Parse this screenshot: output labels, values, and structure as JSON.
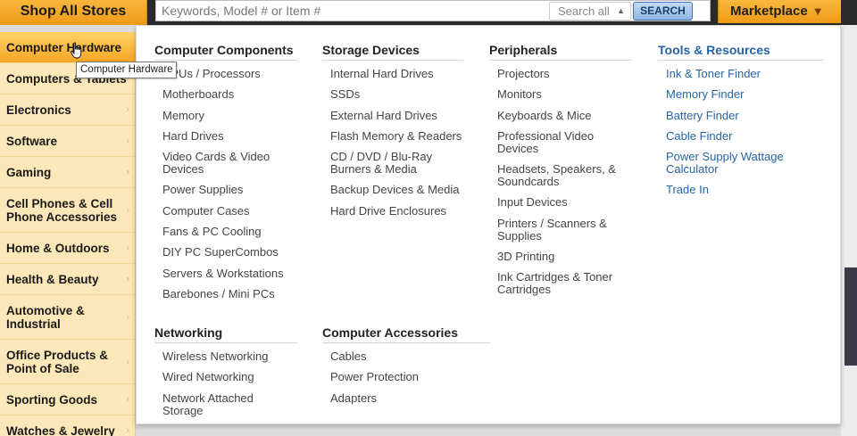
{
  "header": {
    "shop_all": "Shop All Stores",
    "search_placeholder": "Keywords, Model # or Item #",
    "search_scope": "Search all",
    "search_button": "SEARCH",
    "marketplace": "Marketplace"
  },
  "sidebar": {
    "items": [
      {
        "label": "Computer Hardware"
      },
      {
        "label": "Computers & Tablets"
      },
      {
        "label": "Electronics"
      },
      {
        "label": "Software"
      },
      {
        "label": "Gaming"
      },
      {
        "label": "Cell Phones & Cell Phone Accessories"
      },
      {
        "label": "Home & Outdoors"
      },
      {
        "label": "Health & Beauty"
      },
      {
        "label": "Automotive & Industrial"
      },
      {
        "label": "Office Products & Point of Sale"
      },
      {
        "label": "Sporting Goods"
      },
      {
        "label": "Watches & Jewelry"
      }
    ]
  },
  "tooltip": "Computer Hardware",
  "menu": {
    "components": {
      "title": "Computer Components",
      "items": [
        "CPUs / Processors",
        "Motherboards",
        "Memory",
        "Hard Drives",
        "Video Cards & Video Devices",
        "Power Supplies",
        "Computer Cases",
        "Fans & PC Cooling",
        "DIY PC SuperCombos",
        "Servers & Workstations",
        "Barebones / Mini PCs"
      ]
    },
    "storage": {
      "title": "Storage Devices",
      "items": [
        "Internal Hard Drives",
        "SSDs",
        "External Hard Drives",
        "Flash Memory & Readers",
        "CD / DVD / Blu-Ray Burners & Media",
        "Backup Devices & Media",
        "Hard Drive Enclosures"
      ]
    },
    "peripherals": {
      "title": "Peripherals",
      "items": [
        "Projectors",
        "Monitors",
        "Keyboards & Mice",
        "Professional Video Devices",
        "Headsets, Speakers, & Soundcards",
        "Input Devices",
        "Printers / Scanners & Supplies",
        "3D Printing",
        "Ink Cartridges & Toner Cartridges"
      ]
    },
    "tools": {
      "title": "Tools & Resources",
      "items": [
        "Ink & Toner Finder",
        "Memory Finder",
        "Battery Finder",
        "Cable Finder",
        "Power Supply Wattage Calculator",
        "Trade In"
      ]
    },
    "networking": {
      "title": "Networking",
      "items": [
        "Wireless Networking",
        "Wired Networking",
        "Network Attached Storage"
      ]
    },
    "accessories": {
      "title": "Computer Accessories",
      "items": [
        "Cables",
        "Power Protection",
        "Adapters"
      ]
    }
  },
  "colors": {
    "accent_orange": "#f5a623",
    "link_blue": "#2765a4",
    "sidebar_bg": "#fce7b8"
  }
}
